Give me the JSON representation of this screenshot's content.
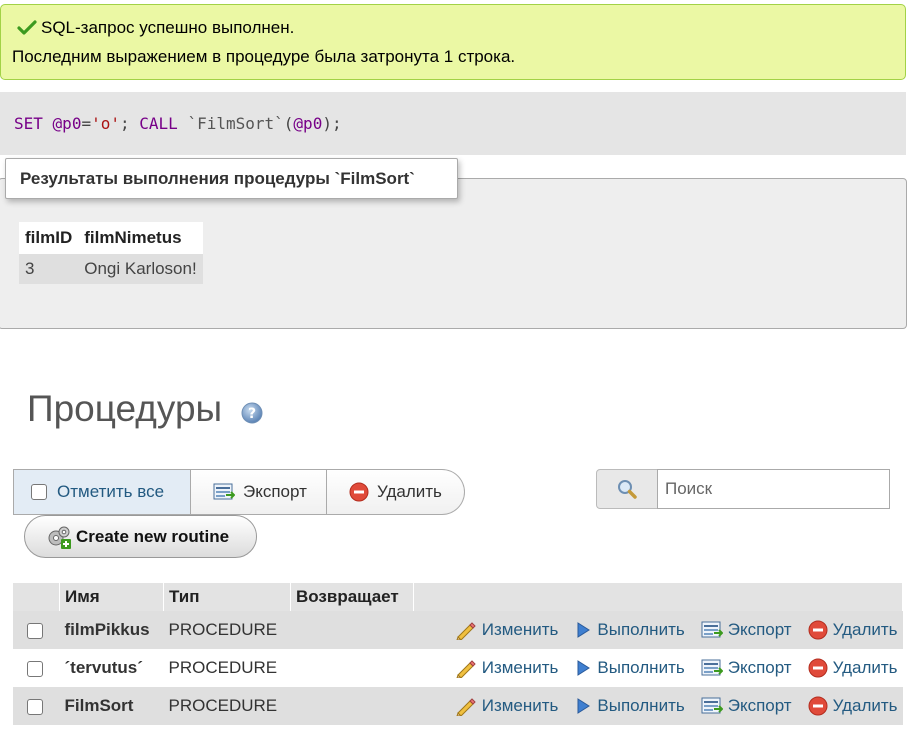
{
  "success": {
    "line1": "SQL-запрос успешно выполнен.",
    "line2": "Последним выражением в процедуре была затронута 1 строка."
  },
  "query": {
    "set_kw": "SET",
    "var1": "@p0",
    "eq": "=",
    "str": "'o'",
    "semi": ";",
    "call_kw": "CALL",
    "proc": "`FilmSort`",
    "paren_open": "(",
    "var2": "@p0",
    "paren_close": ")",
    "end": ";"
  },
  "results": {
    "legend": "Результаты выполнения процедуры `FilmSort`",
    "columns": [
      "filmID",
      "filmNimetus"
    ],
    "rows": [
      [
        "3",
        "Ongi Karloson!"
      ]
    ]
  },
  "procedures": {
    "title": "Процедуры",
    "check_all": "Отметить все",
    "export": "Экспорт",
    "delete": "Удалить",
    "search_placeholder": "Поиск",
    "create": "Create new routine"
  },
  "routines": {
    "columns": [
      "Имя",
      "Тип",
      "Возвращает"
    ],
    "rows": [
      {
        "name": "filmPikkus",
        "type": "PROCEDURE",
        "returns": ""
      },
      {
        "name": "´tervutus´",
        "type": "PROCEDURE",
        "returns": ""
      },
      {
        "name": "FilmSort",
        "type": "PROCEDURE",
        "returns": ""
      }
    ],
    "actions": {
      "edit": "Изменить",
      "execute": "Выполнить",
      "export": "Экспорт",
      "delete": "Удалить"
    }
  },
  "colors": {
    "success_bg": "#ebf8a4",
    "link": "#235a81",
    "keyword": "#770088",
    "string": "#aa1111"
  },
  "icons": [
    "check-icon",
    "help-icon",
    "export-icon",
    "delete-icon",
    "search-icon",
    "routine-icon",
    "edit-icon",
    "execute-icon"
  ]
}
